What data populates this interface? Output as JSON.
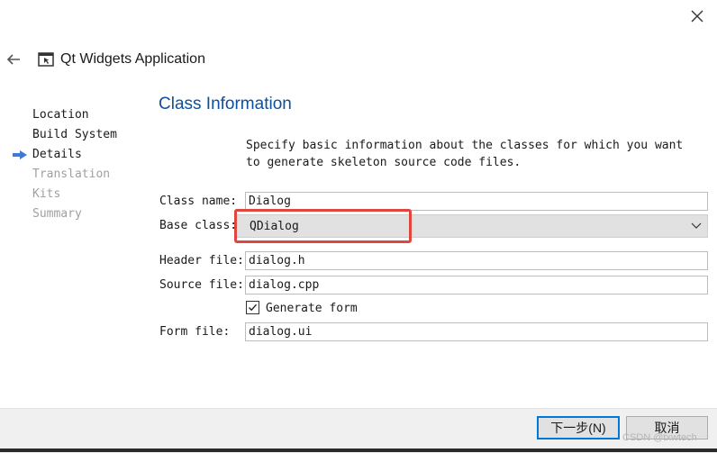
{
  "header": {
    "title": "Qt Widgets Application",
    "back_icon": "back-arrow-icon",
    "app_icon": "qt-app-window-icon",
    "close_icon": "close-icon"
  },
  "steps": [
    {
      "label": "Location",
      "state": "done"
    },
    {
      "label": "Build System",
      "state": "done"
    },
    {
      "label": "Details",
      "state": "current"
    },
    {
      "label": "Translation",
      "state": "pending"
    },
    {
      "label": "Kits",
      "state": "pending"
    },
    {
      "label": "Summary",
      "state": "pending"
    }
  ],
  "page": {
    "title": "Class Information",
    "description": "Specify basic information about the classes for which you want to generate skeleton source code files."
  },
  "form": {
    "class_name": {
      "label": "Class name:",
      "value": "Dialog"
    },
    "base_class": {
      "label": "Base class:",
      "value": "QDialog"
    },
    "header_file": {
      "label": "Header file:",
      "value": "dialog.h"
    },
    "source_file": {
      "label": "Source file:",
      "value": "dialog.cpp"
    },
    "generate_form": {
      "label": "Generate form",
      "checked": true
    },
    "form_file": {
      "label": "Form file:",
      "value": "dialog.ui"
    }
  },
  "footer": {
    "next_label": "下一步(N)",
    "cancel_label": "取消",
    "watermark": "CSDN @txwtech"
  },
  "colors": {
    "title_blue": "#0e4f9c",
    "highlight_red": "#e0463e",
    "focus_blue": "#0078d7",
    "step_arrow": "#3c7ad6"
  }
}
